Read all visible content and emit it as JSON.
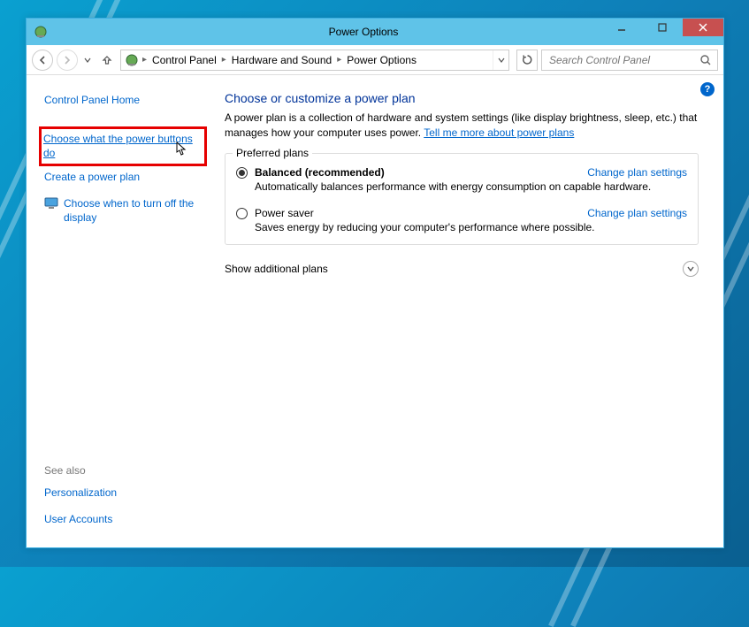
{
  "titlebar": {
    "title": "Power Options"
  },
  "breadcrumbs": {
    "item1": "Control Panel",
    "item2": "Hardware and Sound",
    "item3": "Power Options"
  },
  "search": {
    "placeholder": "Search Control Panel"
  },
  "sidebar": {
    "home": "Control Panel Home",
    "link_power_buttons": "Choose what the power buttons do",
    "link_create_plan": "Create a power plan",
    "link_display_off": "Choose when to turn off the display",
    "see_also_label": "See also",
    "see_also_1": "Personalization",
    "see_also_2": "User Accounts"
  },
  "main": {
    "heading": "Choose or customize a power plan",
    "description_prefix": "A power plan is a collection of hardware and system settings (like display brightness, sleep, etc.) that manages how your computer uses power. ",
    "description_link": "Tell me more about power plans",
    "preferred_label": "Preferred plans",
    "plans": [
      {
        "name": "Balanced (recommended)",
        "desc": "Automatically balances performance with energy consumption on capable hardware.",
        "change": "Change plan settings",
        "checked": true
      },
      {
        "name": "Power saver",
        "desc": "Saves energy by reducing your computer's performance where possible.",
        "change": "Change plan settings",
        "checked": false
      }
    ],
    "expand_label": "Show additional plans"
  }
}
